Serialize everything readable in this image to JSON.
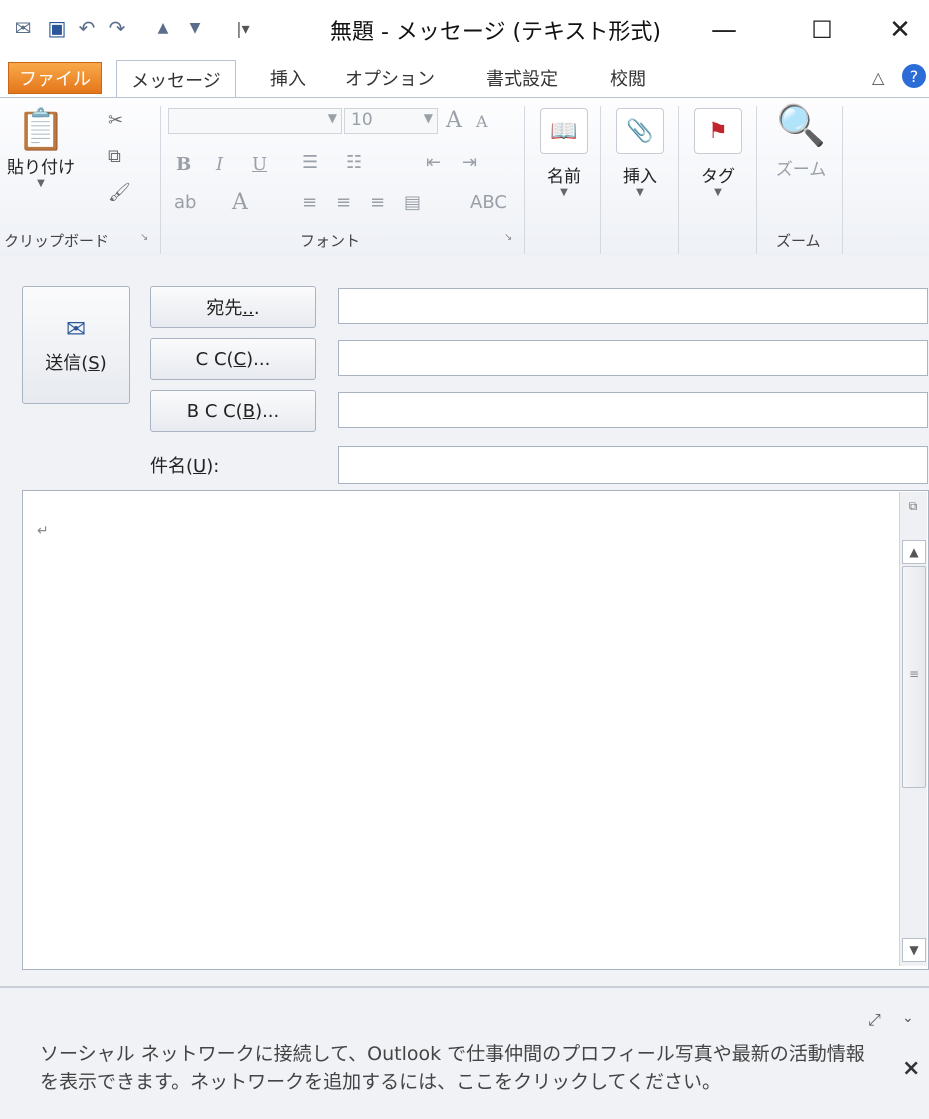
{
  "window": {
    "title": "無題 - メッセージ (テキスト形式)",
    "minimize": "—",
    "maximize": "☐",
    "close": "✕"
  },
  "qat": {
    "icons": [
      "app-icon",
      "save-icon",
      "undo-icon",
      "redo-icon",
      "up-icon",
      "down-icon",
      "customize-icon"
    ]
  },
  "tabs": [
    {
      "label": "ファイル"
    },
    {
      "label": "メッセージ"
    },
    {
      "label": "挿入"
    },
    {
      "label": "オプション"
    },
    {
      "label": "書式設定"
    },
    {
      "label": "校閲"
    }
  ],
  "ribbon": {
    "clipboard": {
      "paste": "貼り付け",
      "group": "クリップボード"
    },
    "font": {
      "size": "10",
      "group": "フォント"
    },
    "names": {
      "label": "名前"
    },
    "insert": {
      "label": "挿入"
    },
    "tag": {
      "label": "タグ"
    },
    "zoom": {
      "label": "ズーム",
      "group": "ズーム"
    }
  },
  "header": {
    "send_text": "送信(",
    "send_key": "S",
    "send_end": ")",
    "to_text": "宛先",
    "to_key": "..",
    "to_end": ".",
    "cc_text": "C C(",
    "cc_key": "C",
    "cc_end": ")...",
    "bcc_text": "B C C(",
    "bcc_key": "B",
    "bcc_end": ")...",
    "subject_text": "件名(",
    "subject_key": "U",
    "subject_end": "):"
  },
  "editor": {
    "para_mark": "↵"
  },
  "social": {
    "text": "ソーシャル ネットワークに接続して、Outlook で仕事仲間のプロフィール写真や最新の活動情報を表示できます。ネットワークを追加するには、ここをクリックしてください。",
    "close": "×"
  },
  "colors": {
    "file_tab": "#e4761a",
    "accent": "#2b579a"
  }
}
